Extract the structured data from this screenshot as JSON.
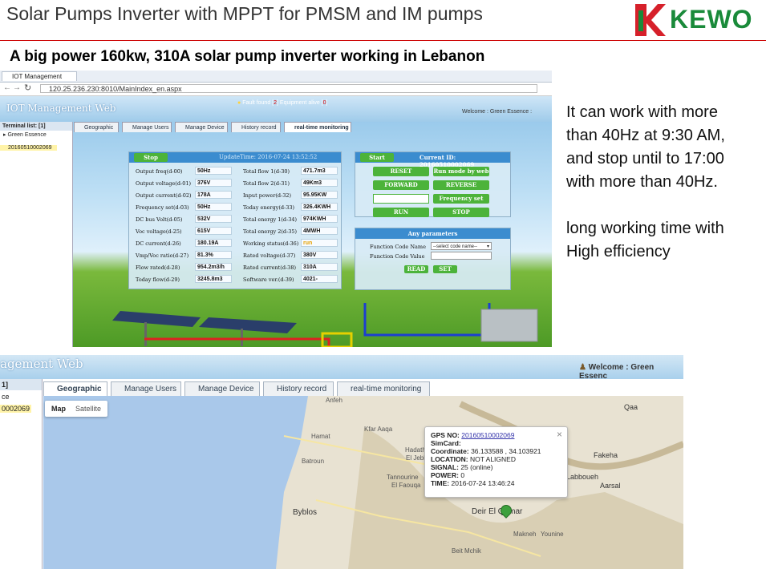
{
  "slide": {
    "title": "Solar Pumps Inverter with MPPT for PMSM and IM pumps",
    "brand": "KEWO",
    "subtitle": "A big power 160kw, 310A solar pump inverter working in Lebanon",
    "description_lines": [
      "It can work with more",
      "than 40Hz at 9:30 AM,",
      "and stop until to 17:00",
      "with more than 40Hz.",
      "",
      "long working time with",
      "High efficiency"
    ]
  },
  "browser": {
    "tab_title": "IOT Management Web",
    "url": "120.25.236.230:8010/MainIndex_en.aspx"
  },
  "app": {
    "title": "IOT Management Web",
    "fault_label": "Fault found",
    "fault_count": "2",
    "equipment_label": "Equipment alive",
    "equipment_count": "0",
    "welcome": "Welcome : Green Essence :",
    "terminal_list": "Terminal list: [1]",
    "tree_root": "Green Essence",
    "tree_device": "20160510002069",
    "tabs": [
      "Geographic",
      "Manage Users",
      "Manage Device",
      "History record",
      "real-time monitoring"
    ]
  },
  "status_panel": {
    "state": "Stop",
    "update_time": "UpdateTime: 2016-07-24 13:52:52",
    "left": [
      {
        "label": "Output freq(d-00)",
        "value": "50Hz"
      },
      {
        "label": "Output voltage(d-01)",
        "value": "376V"
      },
      {
        "label": "Output current(d-02)",
        "value": "178A"
      },
      {
        "label": "Frequency set(d-03)",
        "value": "50Hz"
      },
      {
        "label": "DC bus Volt(d-05)",
        "value": "532V"
      },
      {
        "label": "Voc voltage(d-25)",
        "value": "615V"
      },
      {
        "label": "DC current(d-26)",
        "value": "180.19A"
      },
      {
        "label": "Vmp/Voc ratio(d-27)",
        "value": "81.3%"
      },
      {
        "label": "Flow rated(d-28)",
        "value": "954.2m3/h"
      },
      {
        "label": "Today flow(d-29)",
        "value": "3245.8m3"
      }
    ],
    "right": [
      {
        "label": "Total flow 1(d-30)",
        "value": "471.7m3"
      },
      {
        "label": "Total flow 2(d-31)",
        "value": "49Km3"
      },
      {
        "label": "Input power(d-32)",
        "value": "95.95KW"
      },
      {
        "label": "Today energy(d-33)",
        "value": "326.4KWH"
      },
      {
        "label": "Total energy 1(d-34)",
        "value": "974KWH"
      },
      {
        "label": "Total energy 2(d-35)",
        "value": "4MWH"
      },
      {
        "label": "Working status(d-36)",
        "value": "run"
      },
      {
        "label": "Rated voltage(d-37)",
        "value": "380V"
      },
      {
        "label": "Rated current(d-38)",
        "value": "310A"
      },
      {
        "label": "Software ver.(d-39)",
        "value": "4021-"
      }
    ]
  },
  "control_panel": {
    "start": "Start",
    "current_id": "Current ID: 20160510002069",
    "buttons": [
      "RESET",
      "Run mode by web",
      "FORWARD",
      "REVERSE",
      "Frequency set",
      "RUN",
      "STOP"
    ],
    "params_header": "Any parameters",
    "function_code_name": "Function Code Name",
    "function_code_value": "Function Code Value",
    "select_placeholder": "--select code name--",
    "read": "READ",
    "set": "SET"
  },
  "map_view": {
    "app_title_partial": "agement Web",
    "welcome": "Welcome : Green Essenc",
    "terminal_partial": "1]",
    "tree_root_partial": "ce",
    "tree_device_partial": "0002069",
    "map_type": [
      "Map",
      "Satellite"
    ],
    "places": [
      "Anfeh",
      "Kfar Aaqa",
      "Hamat",
      "Batroun",
      "Hadath",
      "El Jebbe",
      "Tannourine",
      "El Faouqa",
      "Byblos",
      "Deir El Qamar",
      "Makneh",
      "Younine",
      "Beit Mchik",
      "Labboueh",
      "Fakeha",
      "Aarsal",
      "Qaa"
    ],
    "popup": {
      "gps_no_label": "GPS NO:",
      "gps_no": "20160510002069",
      "sim_label": "SimCard:",
      "coord_label": "Coordinate:",
      "coord": "36.133588 , 34.103921",
      "location_label": "LOCATION:",
      "location": "NOT ALIGNED",
      "signal_label": "SIGNAL:",
      "signal": "25 (online)",
      "power_label": "POWER:",
      "power": "0",
      "time_label": "TIME:",
      "time": "2016-07-24 13:46:24",
      "close": "×"
    }
  },
  "colors": {
    "brand_green": "#1a8a3a",
    "brand_red": "#d6202a",
    "button_green": "#4cb33a",
    "panel_blue": "#3b8ccf"
  }
}
